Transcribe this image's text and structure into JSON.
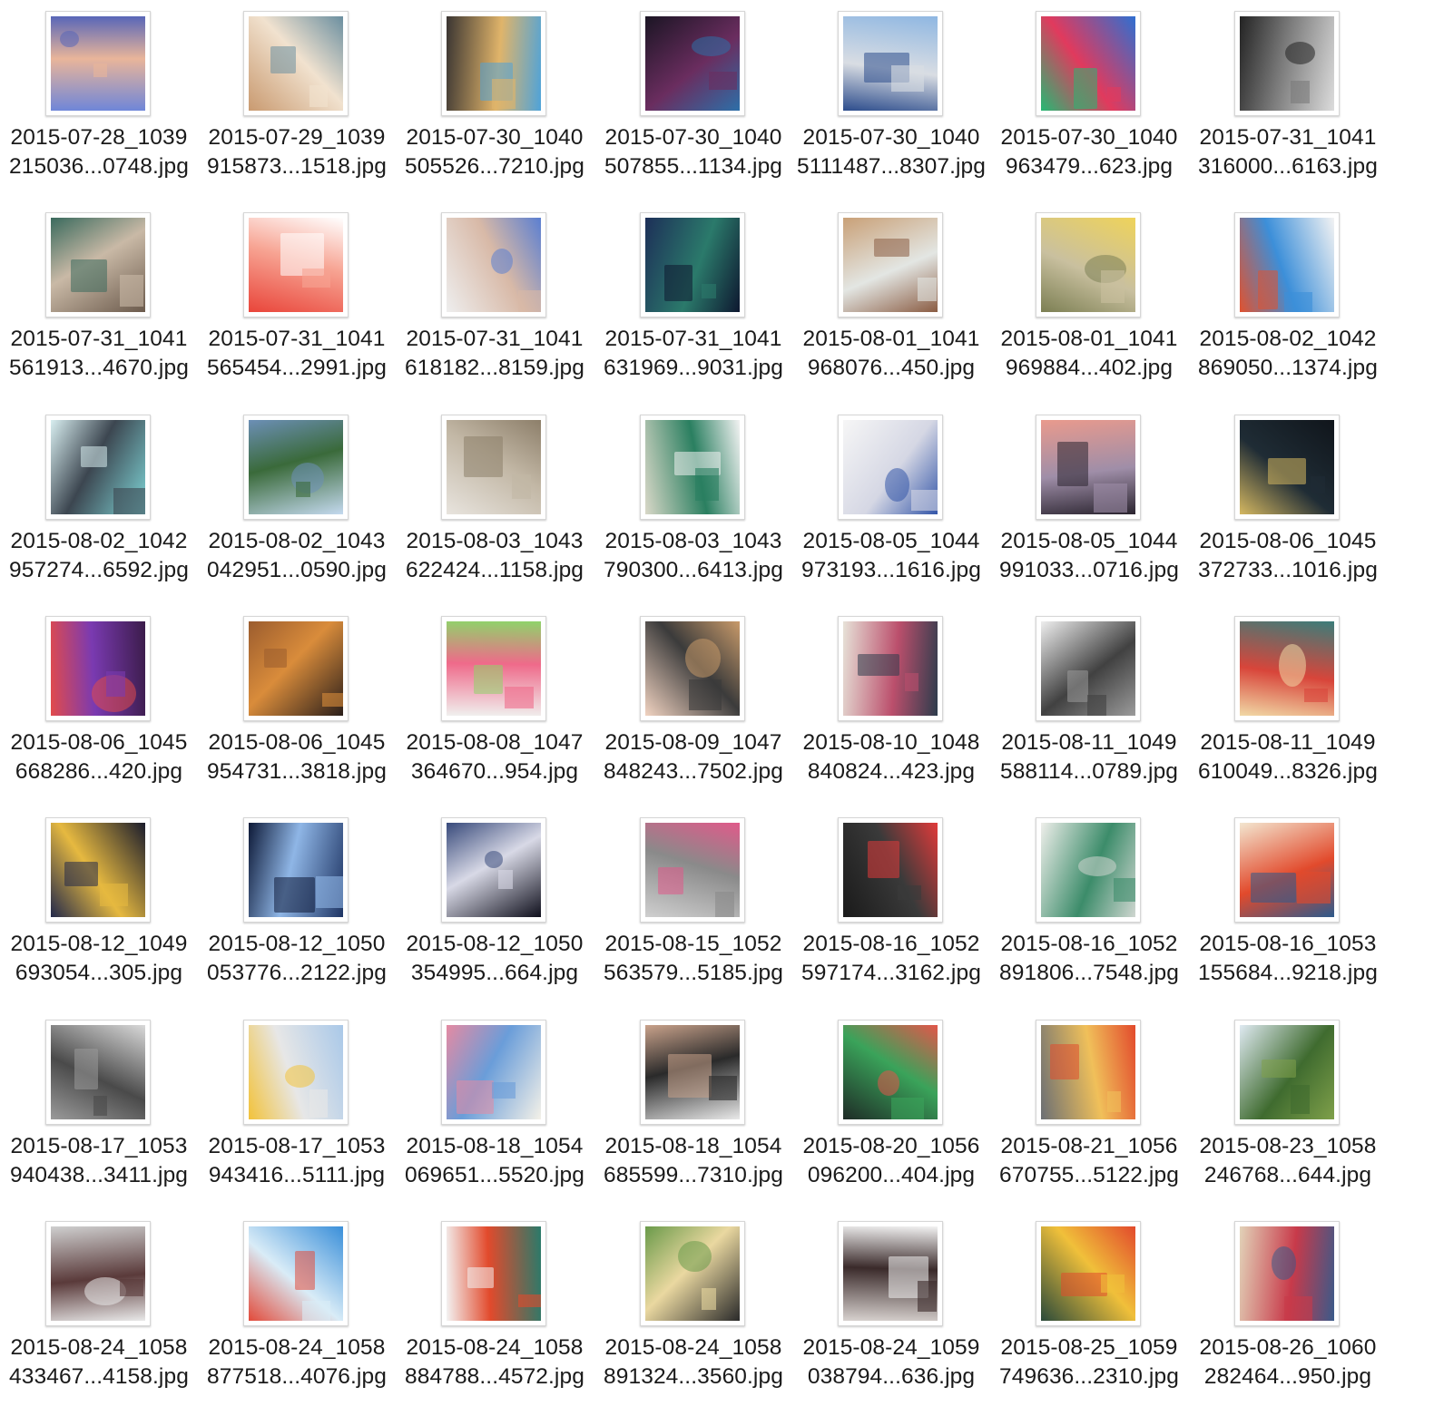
{
  "files": [
    {
      "line1": "2015-07-28_1039",
      "line2": "215036...0748.jpg",
      "colors": [
        "#6f86d8",
        "#e9b59a",
        "#5866b8"
      ]
    },
    {
      "line1": "2015-07-29_1039",
      "line2": "915873...1518.jpg",
      "colors": [
        "#c99a70",
        "#f1e2cf",
        "#6b8fa0"
      ]
    },
    {
      "line1": "2015-07-30_1040",
      "line2": "505526...7210.jpg",
      "colors": [
        "#3a3532",
        "#e0b46a",
        "#4fa3d9"
      ]
    },
    {
      "line1": "2015-07-30_1040",
      "line2": "507855...1134.jpg",
      "colors": [
        "#1b1524",
        "#6a2d5f",
        "#2d6fa8"
      ]
    },
    {
      "line1": "2015-07-30_1040",
      "line2": "5111487...8307.jpg",
      "colors": [
        "#8fb7e2",
        "#d9dde3",
        "#2c4c8c"
      ]
    },
    {
      "line1": "2015-07-30_1040",
      "line2": "963479...623.jpg",
      "colors": [
        "#2f6fd1",
        "#e13a5d",
        "#26b873"
      ]
    },
    {
      "line1": "2015-07-31_1041",
      "line2": "316000...6163.jpg",
      "colors": [
        "#dcdcdc",
        "#7a7a7a",
        "#232323"
      ]
    },
    {
      "line1": "2015-07-31_1041",
      "line2": "561913...4670.jpg",
      "colors": [
        "#6b5a4c",
        "#c9b9a6",
        "#3a6a5d"
      ]
    },
    {
      "line1": "2015-07-31_1041",
      "line2": "565454...2991.jpg",
      "colors": [
        "#e9453a",
        "#f7a493",
        "#ffffff"
      ]
    },
    {
      "line1": "2015-07-31_1041",
      "line2": "618182...8159.jpg",
      "colors": [
        "#eeeeee",
        "#d8b9a7",
        "#5b7fd1"
      ]
    },
    {
      "line1": "2015-07-31_1041",
      "line2": "631969...9031.jpg",
      "colors": [
        "#1d2f58",
        "#2b7a6b",
        "#0e1830"
      ]
    },
    {
      "line1": "2015-08-01_1041",
      "line2": "968076...450.jpg",
      "colors": [
        "#c9a077",
        "#e3e6e3",
        "#8a5c43"
      ]
    },
    {
      "line1": "2015-08-01_1041",
      "line2": "969884...402.jpg",
      "colors": [
        "#efd35a",
        "#c9c09f",
        "#7c7f53"
      ]
    },
    {
      "line1": "2015-08-02_1042",
      "line2": "869050...1374.jpg",
      "colors": [
        "#f3f3f3",
        "#3c8fd9",
        "#e0522f"
      ]
    },
    {
      "line1": "2015-08-02_1042",
      "line2": "957274...6592.jpg",
      "colors": [
        "#7fd6d8",
        "#3c4650",
        "#d8eef0"
      ]
    },
    {
      "line1": "2015-08-02_1043",
      "line2": "042951...0590.jpg",
      "colors": [
        "#c4d9ef",
        "#3a6a3a",
        "#6c8fb6"
      ]
    },
    {
      "line1": "2015-08-03_1043",
      "line2": "622424...1158.jpg",
      "colors": [
        "#e8e4de",
        "#c2b7a5",
        "#8d7f6a"
      ]
    },
    {
      "line1": "2015-08-03_1043",
      "line2": "790300...6413.jpg",
      "colors": [
        "#d9d8c8",
        "#2a7f60",
        "#f2f2f2"
      ]
    },
    {
      "line1": "2015-08-05_1044",
      "line2": "973193...1616.jpg",
      "colors": [
        "#f6f6f6",
        "#d5d7e4",
        "#3355a8"
      ]
    },
    {
      "line1": "2015-08-05_1044",
      "line2": "991033...0716.jpg",
      "colors": [
        "#e99a8d",
        "#9f8ea8",
        "#2b2530"
      ]
    },
    {
      "line1": "2015-08-06_1045",
      "line2": "372733...1016.jpg",
      "colors": [
        "#10151b",
        "#1f2c35",
        "#d5b861"
      ]
    },
    {
      "line1": "2015-08-06_1045",
      "line2": "668286...420.jpg",
      "colors": [
        "#3b1c4a",
        "#7a3ab1",
        "#e24b4b"
      ]
    },
    {
      "line1": "2015-08-06_1045",
      "line2": "954731...3818.jpg",
      "colors": [
        "#2a1e1a",
        "#d98c3b",
        "#9b5c2e"
      ]
    },
    {
      "line1": "2015-08-08_1047",
      "line2": "364670...954.jpg",
      "colors": [
        "#f0f0ee",
        "#ef6a8a",
        "#8fd36a"
      ]
    },
    {
      "line1": "2015-08-09_1047",
      "line2": "848243...7502.jpg",
      "colors": [
        "#f1d3c1",
        "#3b3b3b",
        "#c89a6a"
      ]
    },
    {
      "line1": "2015-08-10_1048",
      "line2": "840824...423.jpg",
      "colors": [
        "#e7e2d8",
        "#bb4f6c",
        "#2d3c4c"
      ]
    },
    {
      "line1": "2015-08-11_1049",
      "line2": "588114...0789.jpg",
      "colors": [
        "#eeeeee",
        "#414141",
        "#9b9b9b"
      ]
    },
    {
      "line1": "2015-08-11_1049",
      "line2": "610049...8326.jpg",
      "colors": [
        "#3b7d7a",
        "#d8453a",
        "#f1d9a6"
      ]
    },
    {
      "line1": "2015-08-12_1049",
      "line2": "693054...305.jpg",
      "colors": [
        "#1a1c2c",
        "#e6b940",
        "#22284a"
      ]
    },
    {
      "line1": "2015-08-12_1050",
      "line2": "053776...2122.jpg",
      "colors": [
        "#1f3564",
        "#8fb6e6",
        "#0e1a38"
      ]
    },
    {
      "line1": "2015-08-12_1050",
      "line2": "354995...664.jpg",
      "colors": [
        "#0f0f1c",
        "#d8d9e6",
        "#384a7b"
      ]
    },
    {
      "line1": "2015-08-15_1052",
      "line2": "563579...5185.jpg",
      "colors": [
        "#cfcfcf",
        "#8a8a8a",
        "#e05a8a"
      ]
    },
    {
      "line1": "2015-08-16_1052",
      "line2": "597174...3162.jpg",
      "colors": [
        "#1a1a1a",
        "#3a3a3a",
        "#e03a3a"
      ]
    },
    {
      "line1": "2015-08-16_1052",
      "line2": "891806...7548.jpg",
      "colors": [
        "#eeeeea",
        "#3c8c6a",
        "#cfd6d0"
      ]
    },
    {
      "line1": "2015-08-16_1053",
      "line2": "155684...9218.jpg",
      "colors": [
        "#f3e6d0",
        "#e24a2c",
        "#2d5a8c"
      ]
    },
    {
      "line1": "2015-08-17_1053",
      "line2": "940438...3411.jpg",
      "colors": [
        "#d9d9d9",
        "#4a4a4a",
        "#9a9a9a"
      ]
    },
    {
      "line1": "2015-08-17_1053",
      "line2": "943416...5111.jpg",
      "colors": [
        "#a9c8e8",
        "#e7e7e7",
        "#f2c23a"
      ]
    },
    {
      "line1": "2015-08-18_1054",
      "line2": "069651...5520.jpg",
      "colors": [
        "#f4f1e8",
        "#6a9dd9",
        "#e58aa2"
      ]
    },
    {
      "line1": "2015-08-18_1054",
      "line2": "685599...7310.jpg",
      "colors": [
        "#e9e9e9",
        "#2a2a2a",
        "#c9a28b"
      ]
    },
    {
      "line1": "2015-08-20_1056",
      "line2": "096200...404.jpg",
      "colors": [
        "#1e2b26",
        "#3aa35a",
        "#e2564a"
      ]
    },
    {
      "line1": "2015-08-21_1056",
      "line2": "670755...5122.jpg",
      "colors": [
        "#6b6f74",
        "#f0c05a",
        "#e24a2c"
      ]
    },
    {
      "line1": "2015-08-23_1058",
      "line2": "246768...644.jpg",
      "colors": [
        "#dfeaf2",
        "#3f6b2f",
        "#7fa04a"
      ]
    },
    {
      "line1": "2015-08-24_1058",
      "line2": "433467...4158.jpg",
      "colors": [
        "#cfcfcf",
        "#5a3a3a",
        "#e9e9e9"
      ]
    },
    {
      "line1": "2015-08-24_1058",
      "line2": "877518...4076.jpg",
      "colors": [
        "#3a8fd9",
        "#d9ecf7",
        "#e24a3a"
      ]
    },
    {
      "line1": "2015-08-24_1058",
      "line2": "884788...4572.jpg",
      "colors": [
        "#2a7a6a",
        "#e24a2c",
        "#f3f3f3"
      ]
    },
    {
      "line1": "2015-08-24_1058",
      "line2": "891324...3560.jpg",
      "colors": [
        "#2a2a2a",
        "#ead8a0",
        "#6a9a4a"
      ]
    },
    {
      "line1": "2015-08-24_1059",
      "line2": "038794...636.jpg",
      "colors": [
        "#d8d2cf",
        "#3a2a2a",
        "#f2f2f2"
      ]
    },
    {
      "line1": "2015-08-25_1059",
      "line2": "749636...2310.jpg",
      "colors": [
        "#2a4a3a",
        "#f0c03a",
        "#e24a2c"
      ]
    },
    {
      "line1": "2015-08-26_1060",
      "line2": "282464...950.jpg",
      "colors": [
        "#e2d2b8",
        "#c83a4a",
        "#3a5a8a"
      ]
    }
  ]
}
